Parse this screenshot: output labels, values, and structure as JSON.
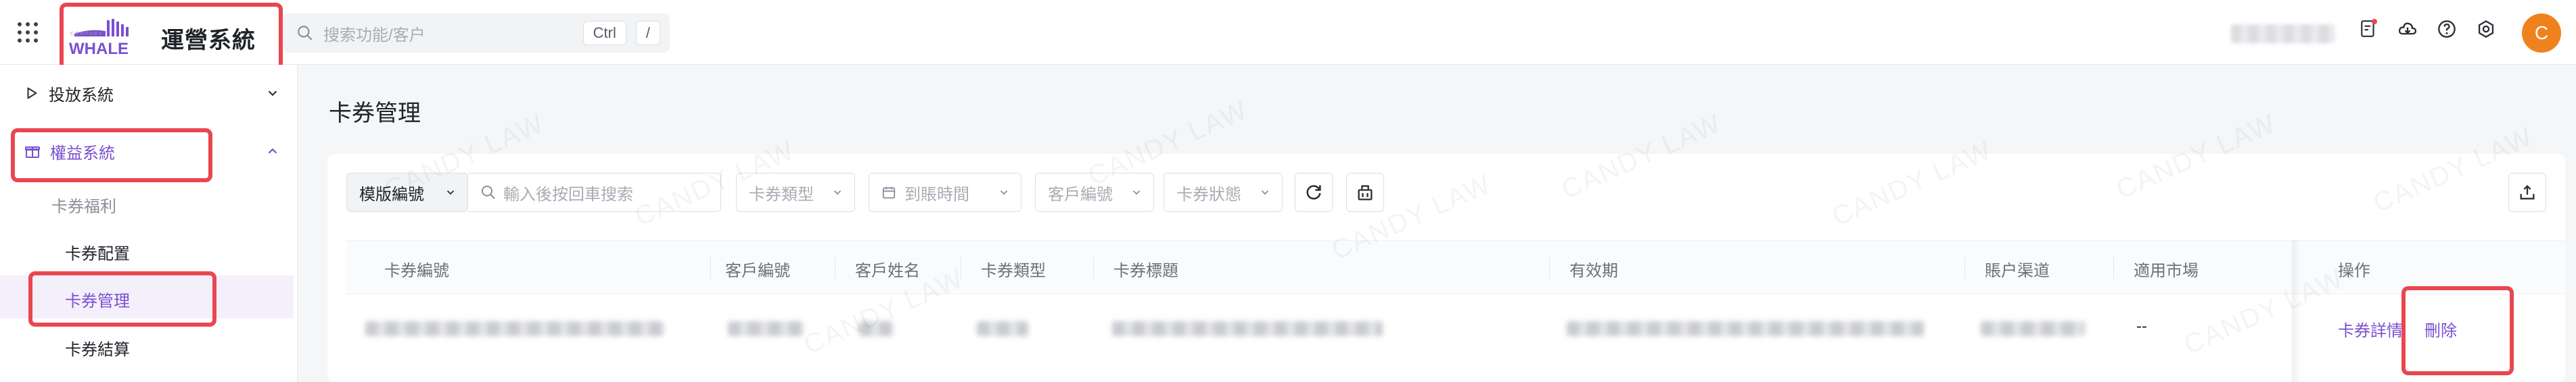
{
  "brand": {
    "logo_text": "WHALE",
    "app_name": "運營系統"
  },
  "search": {
    "placeholder": "搜索功能/客户",
    "shortcut_key_1": "Ctrl",
    "shortcut_key_2": "/"
  },
  "user": {
    "avatar_initial": "C"
  },
  "sidebar": {
    "items": [
      {
        "label": "投放系統",
        "icon": "play-icon",
        "expanded": false
      },
      {
        "label": "權益系統",
        "icon": "gift-icon",
        "expanded": true
      }
    ],
    "group_label": "卡券福利",
    "sub_items": [
      {
        "label": "卡券配置"
      },
      {
        "label": "卡券管理",
        "active": true
      },
      {
        "label": "卡券結算"
      }
    ]
  },
  "page": {
    "title": "卡券管理"
  },
  "filters": {
    "mode_select": "模版編號",
    "search_placeholder": "輸入後按回車搜索",
    "card_type": "卡券類型",
    "arrival_time": "到賬時間",
    "customer_id": "客戶編號",
    "card_status": "卡券狀態"
  },
  "table": {
    "columns": [
      "卡券編號",
      "客戶編號",
      "客戶姓名",
      "卡券類型",
      "卡券標題",
      "有效期",
      "賬户渠道",
      "適用市場",
      "操作"
    ],
    "rows": [
      {
        "market": "--",
        "actions": [
          "卡券詳情",
          "刪除"
        ]
      }
    ]
  },
  "watermark": "CANDY LAW",
  "colors": {
    "accent": "#7b4fd0",
    "highlight": "#e8474f",
    "avatar": "#f0821e"
  }
}
